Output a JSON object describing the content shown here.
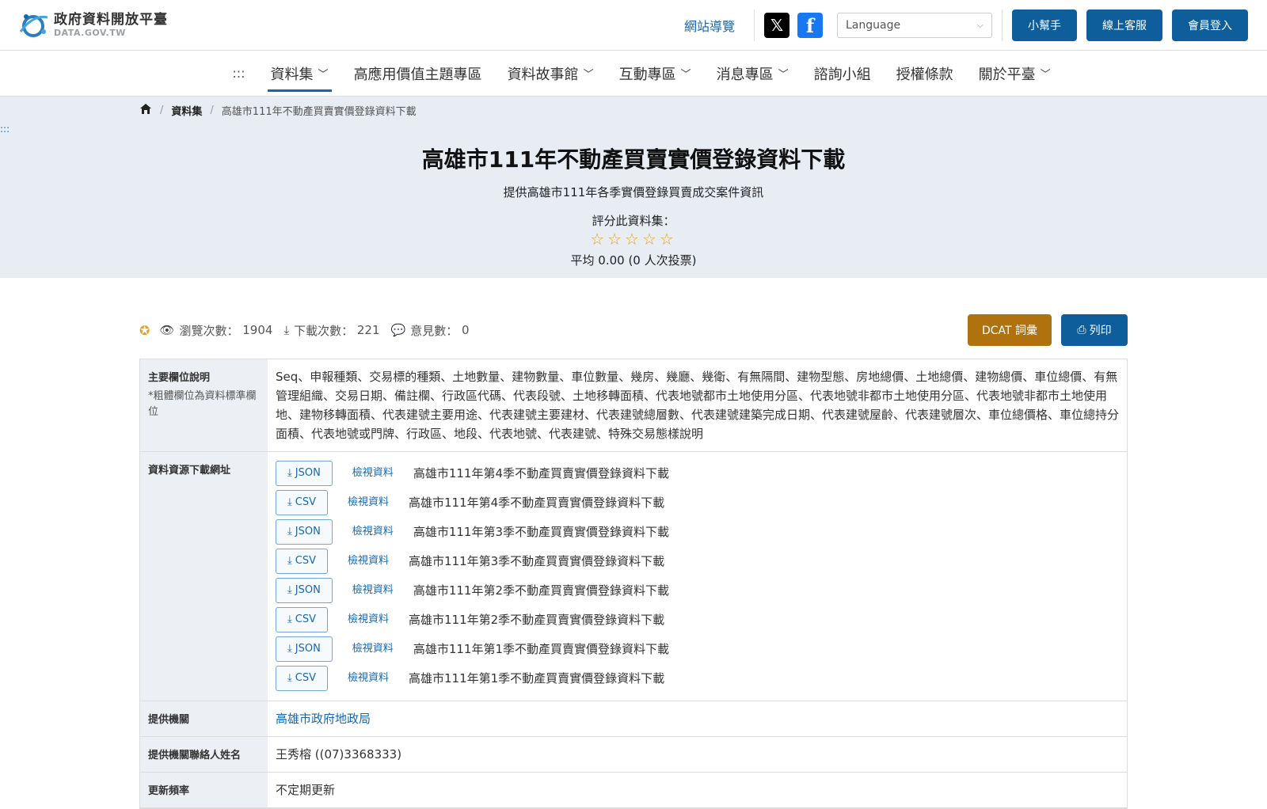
{
  "header": {
    "logo_cn": "政府資料開放平臺",
    "logo_en": "DATA.GOV.TW",
    "sitemap": "網站導覽",
    "language_placeholder": "Language",
    "helper": "小幫手",
    "support": "線上客服",
    "login": "會員登入"
  },
  "nav": {
    "anchor": ":::",
    "items": [
      {
        "label": "資料集"
      },
      {
        "label": "高應用價值主題專區"
      },
      {
        "label": "資料故事館"
      },
      {
        "label": "互動專區"
      },
      {
        "label": "消息專區"
      },
      {
        "label": "諮詢小組"
      },
      {
        "label": "授權條款"
      },
      {
        "label": "關於平臺"
      }
    ]
  },
  "breadcrumb": {
    "level1": "資料集",
    "level2": "高雄市111年不動產買賣實價登錄資料下載"
  },
  "hero": {
    "anchor": ":::",
    "title": "高雄市111年不動產買賣實價登錄資料下載",
    "subtitle": "提供高雄市111年各季實價登錄買賣成交案件資訊",
    "rate_label": "評分此資料集：",
    "stars": "☆☆☆☆☆",
    "average": "平均 0.00 (0 人次投票)"
  },
  "stats": {
    "views_label": "瀏覽次數：",
    "views": "1904",
    "downloads_label": "下載次數：",
    "downloads": "221",
    "comments_label": "意見數：",
    "comments": "0"
  },
  "actions": {
    "dcat": "DCAT 詞彙",
    "print": "列印"
  },
  "table": {
    "fields_header": "主要欄位說明",
    "fields_note": "*粗體欄位為資料標準欄位",
    "fields_value": "Seq、申報種類、交易標的種類、土地數量、建物數量、車位數量、幾房、幾廳、幾衛、有無隔間、建物型態、房地總價、土地總價、建物總價、車位總價、有無管理組織、交易日期、備註欄、行政區代碼、代表段號、土地移轉面積、代表地號都市土地使用分區、代表地號非都市土地使用分區、代表地號非都市土地使用地、建物移轉面積、代表建號主要用途、代表建號主要建材、代表建號總層數、代表建號建築完成日期、代表建號屋齡、代表建號層次、車位總價格、車位總持分面積、代表地號或門牌、行政區、地段、代表地號、代表建號、特殊交易態樣說明",
    "resources_header": "資料資源下載網址",
    "view_label": "檢視資料",
    "resources": [
      {
        "format": "JSON",
        "title": "高雄市111年第4季不動產買賣實價登錄資料下載"
      },
      {
        "format": "CSV",
        "title": "高雄市111年第4季不動產買賣實價登錄資料下載"
      },
      {
        "format": "JSON",
        "title": "高雄市111年第3季不動產買賣實價登錄資料下載"
      },
      {
        "format": "CSV",
        "title": "高雄市111年第3季不動產買賣實價登錄資料下載"
      },
      {
        "format": "JSON",
        "title": "高雄市111年第2季不動產買賣實價登錄資料下載"
      },
      {
        "format": "CSV",
        "title": "高雄市111年第2季不動產買賣實價登錄資料下載"
      },
      {
        "format": "JSON",
        "title": "高雄市111年第1季不動產買賣實價登錄資料下載"
      },
      {
        "format": "CSV",
        "title": "高雄市111年第1季不動產買賣實價登錄資料下載"
      }
    ],
    "provider_header": "提供機關",
    "provider_value": "高雄市政府地政局",
    "contact_header": "提供機關聯絡人姓名",
    "contact_value": "王秀榕 ((07)3368333)",
    "update_header": "更新頻率",
    "update_value": "不定期更新"
  }
}
